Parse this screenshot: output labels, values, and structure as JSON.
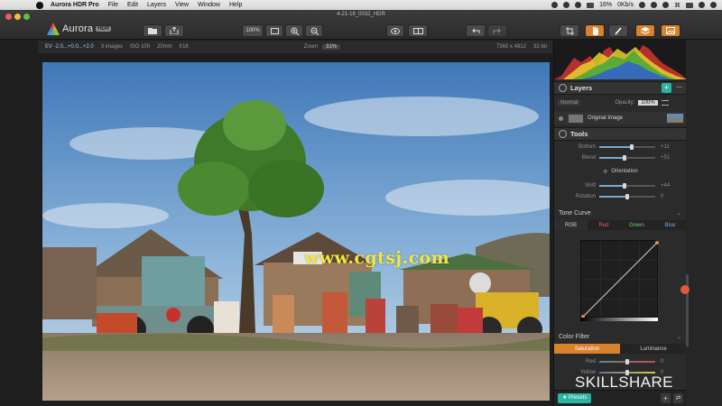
{
  "menubar": {
    "app": "Aurora HDR Pro",
    "items": [
      "File",
      "Edit",
      "Layers",
      "View",
      "Window",
      "Help"
    ],
    "battery": "16%",
    "network": "0Kb/s",
    "status_glyph": "⌘"
  },
  "window": {
    "title": "4-21-16_0032_HDR"
  },
  "logo": {
    "name": "Aurora",
    "badge": "HDR"
  },
  "toolbar": {
    "zoom_100": "100%",
    "open_icon": "folder-icon",
    "share_icon": "share-icon",
    "fit_icon": "fit-screen-icon",
    "zoom_in_icon": "zoom-in-icon",
    "zoom_out_icon": "zoom-out-icon",
    "preview_icon": "eye-icon",
    "compare_icon": "split-view-icon",
    "undo_icon": "undo-icon",
    "redo_icon": "redo-icon",
    "crop_icon": "crop-icon",
    "hand_icon": "hand-icon",
    "brush_icon": "brush-icon",
    "layers_icon": "layers-icon",
    "presets_icon": "image-icon"
  },
  "info": {
    "ev": "EV -2.0...+0.0...+2.0",
    "images": "3 images",
    "iso": "ISO 100",
    "focal": "20mm",
    "aperture": "f/16",
    "zoom_label": "Zoom",
    "zoom_value": "31%",
    "dimensions": "7360 x 4912",
    "bitdepth": "32-bit"
  },
  "watermark": "www.cgtsj.com",
  "panel": {
    "layers": {
      "title": "Layers",
      "add_label": "+",
      "more_label": "—",
      "blend_mode": "Normal",
      "opacity_label": "Opacity:",
      "opacity_value": "100%",
      "layer_name": "Original Image"
    },
    "tools": {
      "title": "Tools",
      "sliders": [
        {
          "label": "Bottom",
          "value": "+11",
          "level": 0.58
        },
        {
          "label": "Blend",
          "value": "+51",
          "level": 0.45
        }
      ],
      "orientation_label": "Orientation",
      "orientation_sliders": [
        {
          "label": "Shift",
          "value": "+44",
          "level": 0.45
        },
        {
          "label": "Rotation",
          "value": "0",
          "level": 0.5
        }
      ]
    },
    "tone_curve": {
      "title": "Tone Curve",
      "tabs": [
        {
          "label": "RGB",
          "color": "#cfcfcf"
        },
        {
          "label": "Red",
          "color": "#e05a5a"
        },
        {
          "label": "Green",
          "color": "#6fd06f"
        },
        {
          "label": "Blue",
          "color": "#6fa8e8"
        }
      ]
    },
    "color_filter": {
      "title": "Color Filter",
      "tabs": [
        "Saturation",
        "Luminance"
      ],
      "sliders": [
        {
          "label": "Red",
          "value": "0",
          "level": 0.5
        },
        {
          "label": "Yellow",
          "value": "0",
          "level": 0.5
        }
      ]
    },
    "presets_label": "★ Presets",
    "bottom_add": "+",
    "bottom_sync": "⇄"
  },
  "brand_overlay": "SKILLSHARE",
  "colors": {
    "accent": "#2bb3a5",
    "orange": "#d9822b"
  }
}
